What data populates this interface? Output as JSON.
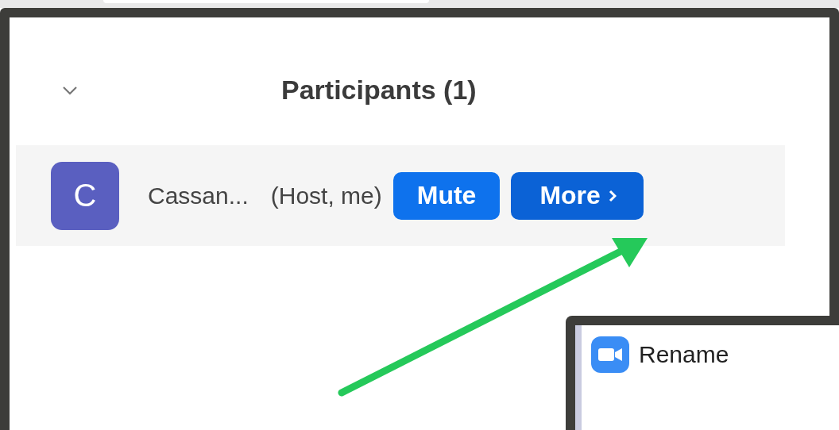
{
  "panel": {
    "title": "Participants (1)",
    "collapsed": false
  },
  "participants": [
    {
      "initial": "C",
      "name": "Cassan...",
      "role": "(Host, me)",
      "color": "#5a5fc0"
    }
  ],
  "buttons": [
    {
      "label": "Mute",
      "kind": "plain"
    },
    {
      "label": "More",
      "kind": "menu"
    }
  ],
  "menu": {
    "items": [
      {
        "label": "Rename"
      }
    ]
  }
}
